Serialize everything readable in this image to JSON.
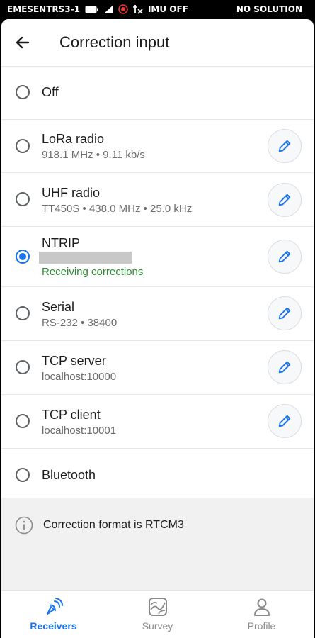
{
  "status_bar": {
    "device": "EMESENTRS3-1",
    "imu": "IMU OFF",
    "solution": "NO SOLUTION",
    "icons": [
      "battery-icon",
      "signal-icon",
      "record-icon",
      "imu-off-icon"
    ]
  },
  "app_bar": {
    "back_icon": "arrow-back-icon",
    "title": "Correction input"
  },
  "options": [
    {
      "label": "Off",
      "selected": false,
      "editable": false
    },
    {
      "label": "LoRa radio",
      "detail": "918.1 MHz • 9.11 kb/s",
      "selected": false,
      "editable": true
    },
    {
      "label": "UHF radio",
      "detail": "TT450S • 438.0 MHz • 25.0 kHz",
      "selected": false,
      "editable": true
    },
    {
      "label": "NTRIP",
      "detail_redacted": true,
      "status": "Receiving corrections",
      "selected": true,
      "editable": true
    },
    {
      "label": "Serial",
      "detail": "RS-232 • 38400",
      "selected": false,
      "editable": true
    },
    {
      "label": "TCP server",
      "detail": "localhost:10000",
      "selected": false,
      "editable": true
    },
    {
      "label": "TCP client",
      "detail": "localhost:10001",
      "selected": false,
      "editable": true
    },
    {
      "label": "Bluetooth",
      "selected": false,
      "editable": false
    }
  ],
  "info": {
    "icon": "info-icon",
    "text": "Correction format is RTCM3"
  },
  "bottom_nav": [
    {
      "label": "Receivers",
      "icon": "satellite-dish-icon",
      "active": true
    },
    {
      "label": "Survey",
      "icon": "map-icon",
      "active": false
    },
    {
      "label": "Profile",
      "icon": "person-icon",
      "active": false
    }
  ],
  "colors": {
    "accent": "#1a73e8",
    "status_ok": "#2e8b35",
    "divider": "#e6e6e6",
    "info_bg": "#f1f1f1"
  }
}
